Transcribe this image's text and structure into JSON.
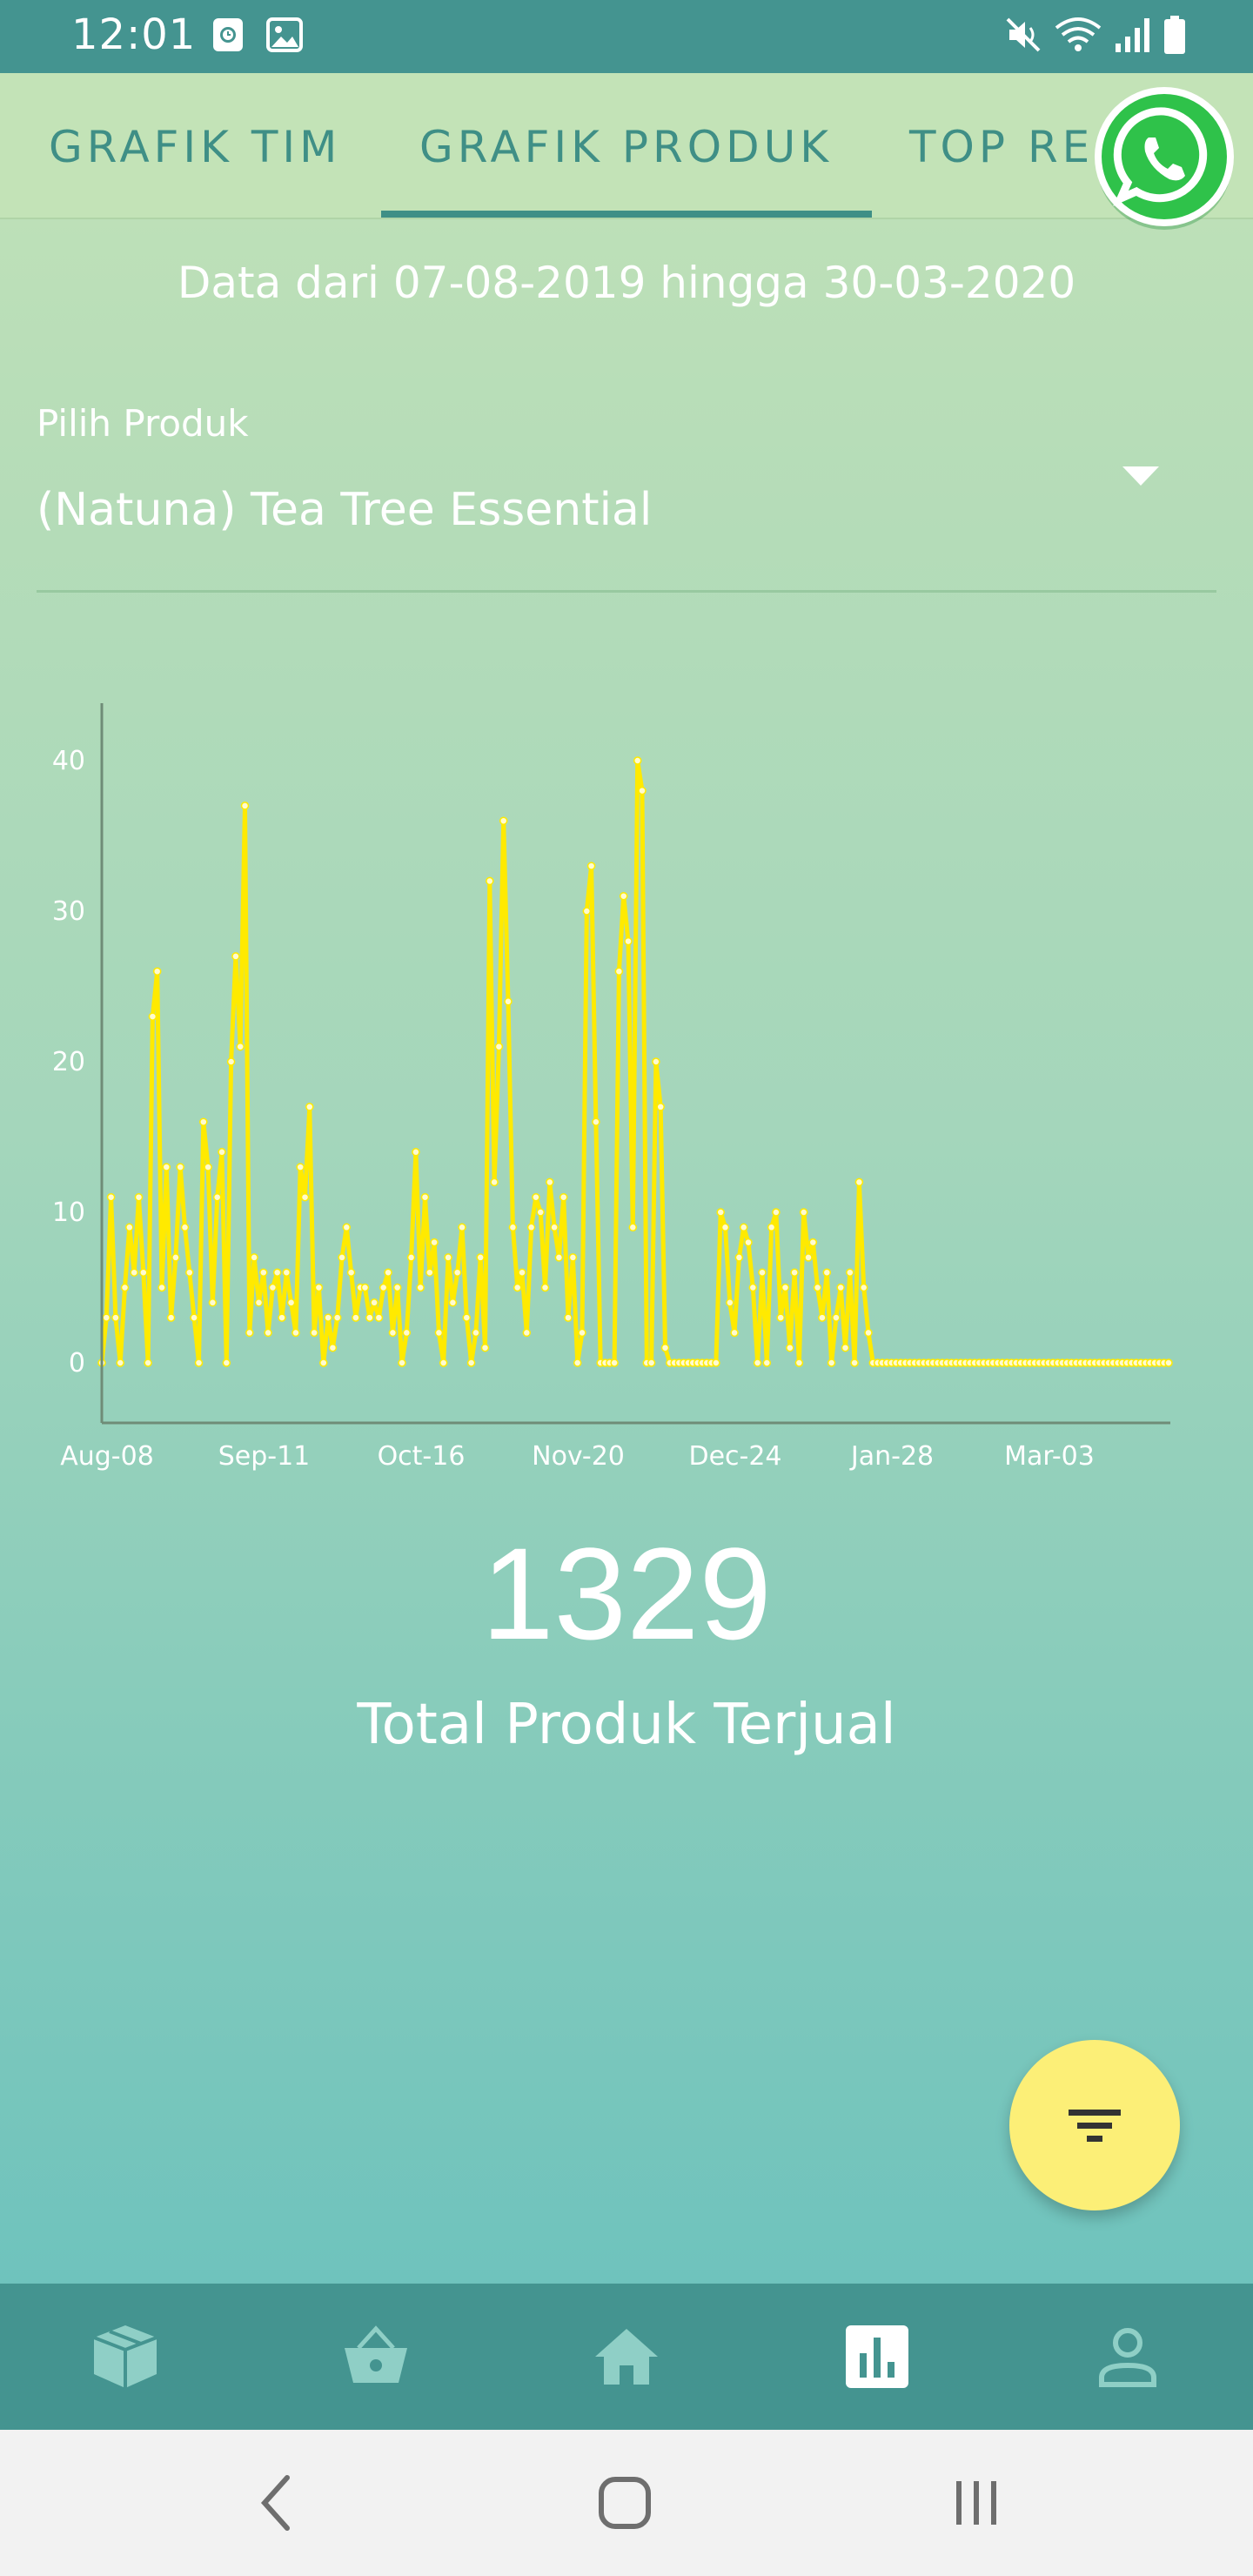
{
  "status_bar": {
    "time": "12:01",
    "left_icons": [
      "clock-app-icon",
      "image-icon"
    ],
    "right_icons": [
      "mute-icon",
      "wifi-icon",
      "signal-icon",
      "battery-icon"
    ],
    "bg_color": "#449490"
  },
  "tabs": [
    {
      "label": "GRAFIK TIM",
      "selected": false
    },
    {
      "label": "GRAFIK PRODUK",
      "selected": true
    },
    {
      "label": "TOP RE",
      "selected": false
    }
  ],
  "date_range": "Data dari 07-08-2019 hingga 30-03-2020",
  "product_select": {
    "label": "Pilih Produk",
    "value": "(Natuna) Tea Tree Essential"
  },
  "chart_data": {
    "type": "line",
    "title": "",
    "xlabel": "",
    "ylabel": "",
    "x_ticks": [
      "Aug-08",
      "Sep-11",
      "Oct-16",
      "Nov-20",
      "Dec-24",
      "Jan-28",
      "Mar-03"
    ],
    "y_ticks": [
      "0",
      "10",
      "20",
      "30",
      "40"
    ],
    "ylim": [
      0,
      44
    ],
    "x_start": "2019-08-07",
    "x_end": "2020-03-30",
    "color": "#ffea00",
    "values": [
      0,
      3,
      11,
      3,
      0,
      5,
      9,
      6,
      11,
      6,
      0,
      23,
      26,
      5,
      13,
      3,
      7,
      13,
      9,
      6,
      3,
      0,
      16,
      13,
      4,
      11,
      14,
      0,
      20,
      27,
      21,
      37,
      2,
      7,
      4,
      6,
      2,
      5,
      6,
      3,
      6,
      4,
      2,
      13,
      11,
      17,
      2,
      5,
      0,
      3,
      1,
      3,
      7,
      9,
      6,
      3,
      5,
      5,
      3,
      4,
      3,
      5,
      6,
      2,
      5,
      0,
      2,
      7,
      14,
      5,
      11,
      6,
      8,
      2,
      0,
      7,
      4,
      6,
      9,
      3,
      0,
      2,
      7,
      1,
      32,
      12,
      21,
      36,
      24,
      9,
      5,
      6,
      2,
      9,
      11,
      10,
      5,
      12,
      9,
      7,
      11,
      3,
      7,
      0,
      2,
      30,
      33,
      16,
      0,
      0,
      0,
      0,
      26,
      31,
      28,
      9,
      40,
      38,
      0,
      0,
      20,
      17,
      1,
      0,
      0,
      0,
      0,
      0,
      0,
      0,
      0,
      0,
      0,
      0,
      10,
      9,
      4,
      2,
      7,
      9,
      8,
      5,
      0,
      6,
      0,
      9,
      10,
      3,
      5,
      1,
      6,
      0,
      10,
      7,
      8,
      5,
      3,
      6,
      0,
      3,
      5,
      1,
      6,
      0,
      12,
      5,
      2,
      0,
      0,
      0,
      0,
      0,
      0,
      0,
      0,
      0,
      0,
      0,
      0,
      0,
      0,
      0,
      0,
      0,
      0,
      0,
      0,
      0,
      0,
      0,
      0,
      0,
      0,
      0,
      0,
      0,
      0,
      0,
      0,
      0,
      0,
      0,
      0,
      0,
      0,
      0,
      0,
      0,
      0,
      0,
      0,
      0,
      0,
      0,
      0,
      0,
      0,
      0,
      0,
      0,
      0,
      0,
      0,
      0,
      0,
      0,
      0,
      0,
      0,
      0,
      0,
      0
    ]
  },
  "total": {
    "value": "1329",
    "label": "Total Produk Terjual"
  },
  "fab": {
    "icon": "filter-icon",
    "color": "#fcef77"
  },
  "bottom_nav": {
    "items": [
      "box-icon",
      "basket-icon",
      "home-icon",
      "chart-icon",
      "person-icon"
    ],
    "active": "chart-icon",
    "bg_color": "#449490"
  },
  "system_nav": [
    "back-icon",
    "home-circle-icon",
    "recents-icon"
  ]
}
